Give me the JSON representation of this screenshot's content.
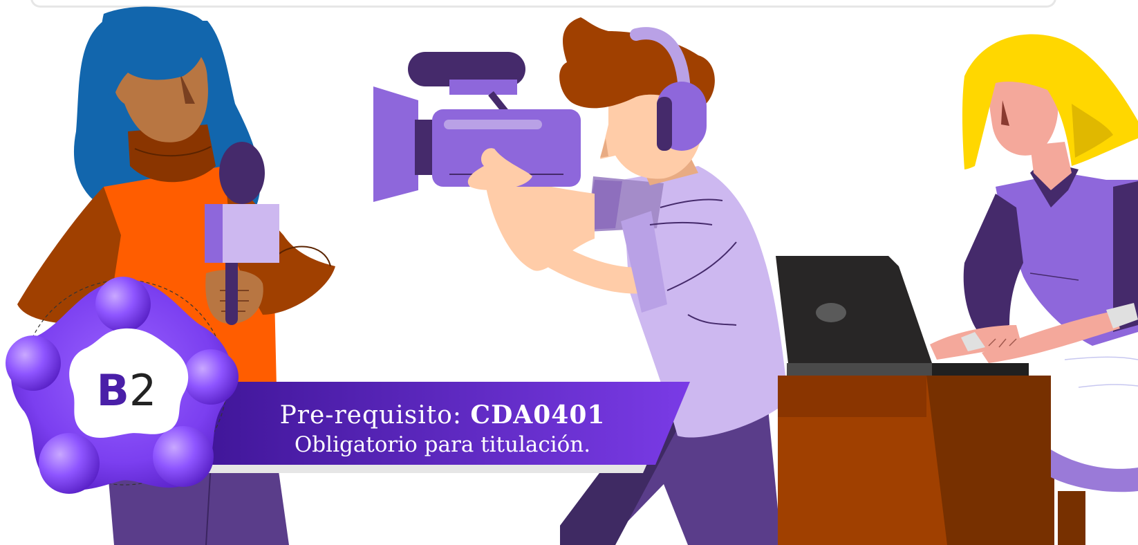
{
  "banner": {
    "prefix": "Pre-requisito: ",
    "code": "CDA0401",
    "note": "Obligatorio para titulación."
  },
  "badge": {
    "letter": "B",
    "number": "2"
  },
  "colors": {
    "banner_purple": "#6a2fd8",
    "banner_dark": "#3f1597",
    "badge_purple": "#7b3ff0",
    "jacket_orange": "#ff5d00",
    "hair_blue": "#1266ad",
    "hair_yellow": "#ffd700",
    "camera_purple": "#8e67db",
    "desk_brown": "#a04000"
  },
  "icons": {
    "badge": "level-badge-icon",
    "camera": "video-camera-icon",
    "microphone": "microphone-icon",
    "laptop": "laptop-icon"
  }
}
